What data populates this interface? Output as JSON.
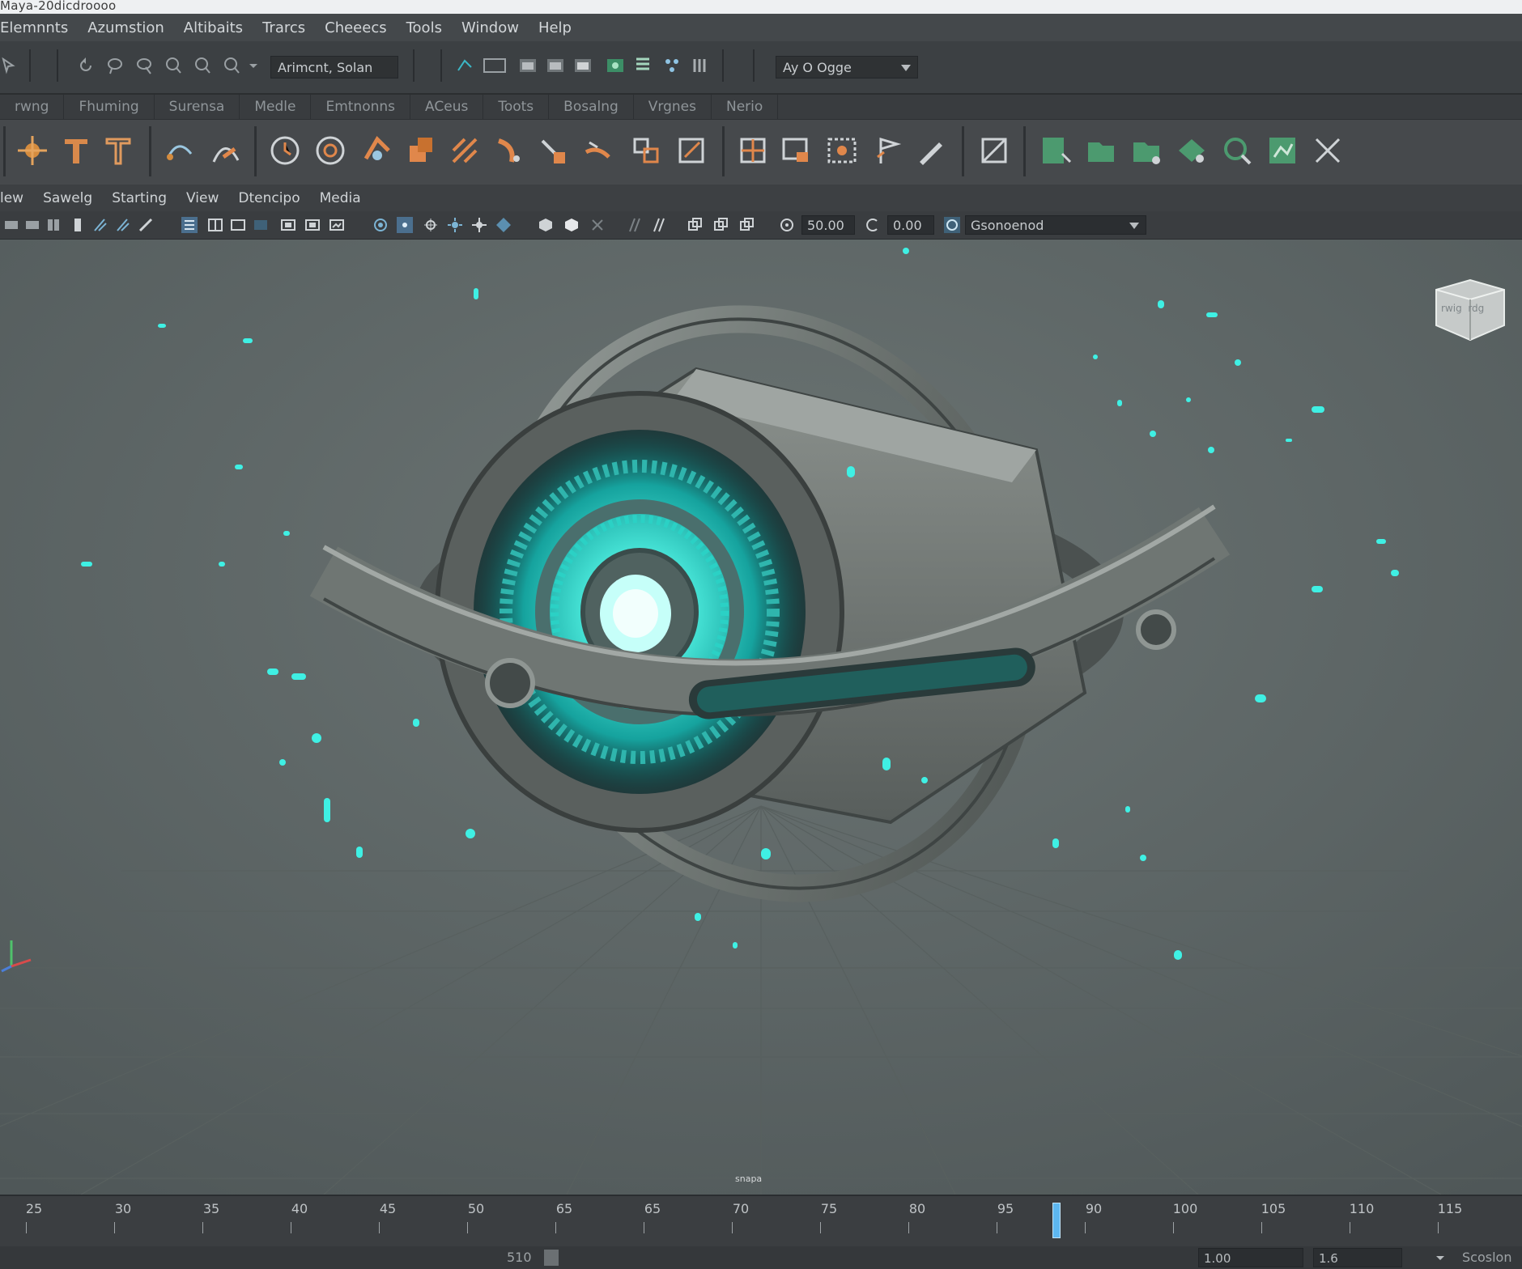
{
  "window": {
    "title": "Maya-20dicdroooo"
  },
  "menubar": {
    "items": [
      "Elemnnts",
      "Azumstion",
      "Altibaits",
      "Trarcs",
      "Cheeecs",
      "Tools",
      "Window",
      "Help"
    ]
  },
  "statusline": {
    "field_value": "Arimcnt, Solan",
    "dropdown_value": "Ay O Ogge"
  },
  "shelf_tabs": {
    "items": [
      "rwng",
      "Fhuming",
      "Surensa",
      "Medle",
      "Emtnonns",
      "ACeus",
      "Toots",
      "Bosalng",
      "Vrgnes",
      "Nerio"
    ]
  },
  "panel_menu": {
    "items": [
      "lew",
      "Sawelg",
      "Starting",
      "View",
      "Dtencipo",
      "Media"
    ]
  },
  "panel_toolbar": {
    "field1_value": "50.00",
    "field2_value": "0.00",
    "display_dropdown": "Gsonoenod"
  },
  "viewport": {
    "viewcube_label": "rwig  rdg",
    "bottom_label": "snapa",
    "accent_color": "#3ff0e4"
  },
  "timeline": {
    "tick_labels": [
      "25",
      "30",
      "35",
      "40",
      "45",
      "50",
      "65",
      "65",
      "70",
      "75",
      "80",
      "95",
      "90",
      "100",
      "105",
      "110",
      "115"
    ],
    "current_frame_marker": "between 95 and 90"
  },
  "rangebar": {
    "frame_label": "510",
    "field1_value": "1.00",
    "field2_value": "1.6",
    "right_label": "Scoslon"
  }
}
